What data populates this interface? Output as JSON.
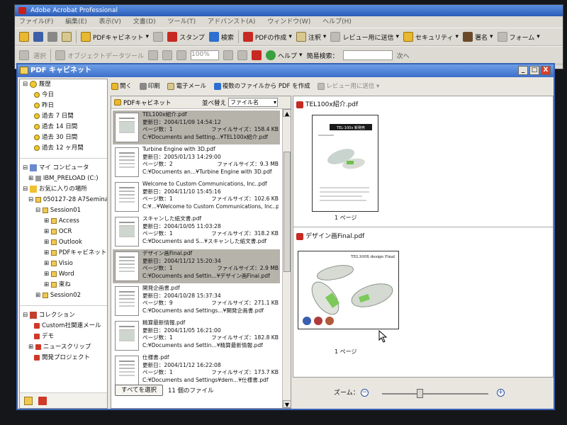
{
  "app": {
    "title": "Adobe Acrobat Professional",
    "menu": [
      "ファイル(F)",
      "編集(E)",
      "表示(V)",
      "文書(D)",
      "ツール(T)",
      "アドバンスト(A)",
      "ウィンドウ(W)",
      "ヘルプ(H)"
    ],
    "toolbar1": {
      "pdf_cabinet": "PDFキャビネット",
      "stamp": "スタンプ",
      "search": "検索",
      "create_pdf": "PDFの作成",
      "comment": "注釈",
      "send_for_review": "レビュー用に送信",
      "security": "セキュリティ",
      "sign": "署名",
      "forms": "フォーム"
    },
    "toolbar2": {
      "select": "選択",
      "object_data": "オブジェクトデータツール",
      "zoom_value": "100%",
      "help": "ヘルプ",
      "quick_search_label": "簡易検索：",
      "next": "次へ"
    }
  },
  "organizer": {
    "title": "PDF キャビネット",
    "window_buttons": {
      "minimize": "_",
      "maximize": "□",
      "close": "X"
    },
    "toolbar": {
      "open": "開く",
      "print": "印刷",
      "email": "電子メール",
      "combine": "複数のファイルから PDF を作成",
      "send_review": "レビュー用に送信"
    },
    "tree": {
      "history": {
        "label": "履歴",
        "items": [
          "今日",
          "昨日",
          "過去 7 日間",
          "過去 14 日間",
          "過去 30 日間",
          "過去 12 ヶ月間"
        ]
      },
      "my_computer": "マイ コンピュータ",
      "drive": "IBM_PRELOAD (C:)",
      "favorites": "お気に入りの場所",
      "fav_folder": "050127-28 A7Seminar",
      "session01": "Session01",
      "session01_children": [
        "Access",
        "OCR",
        "Outlook",
        "PDFキャビネット",
        "Visio",
        "Word",
        "束ね"
      ],
      "session02": "Session02",
      "collections": {
        "label": "コレクション",
        "items": [
          "Custom社関連メール",
          "デモ",
          "ニュースクリップ",
          "開発プロジェクト"
        ]
      }
    },
    "file_list": {
      "folder": "PDFキャビネット",
      "sort_label": "並べ替え",
      "sort_value": "ファイル名",
      "labels": {
        "modified": "更新日：",
        "pages": "ページ数：",
        "size": "ファイルサイズ："
      },
      "files": [
        {
          "name": "TEL100x紹介.pdf",
          "modified": "2004/11/09 14:54:12",
          "pages": "1",
          "size": "158.4 KB",
          "path": "C:¥Documents and Setting...¥TEL100x紹介.pdf",
          "selected": true
        },
        {
          "name": "Turbine Engine with 3D.pdf",
          "modified": "2005/01/13 14:29:00",
          "pages": "2",
          "size": "9.3 MB",
          "path": "C:¥Documents an...¥Turbine Engine with 3D.pdf",
          "selected": false
        },
        {
          "name": "Welcome to Custom Communications, Inc..pdf",
          "modified": "2004/11/10 15:45:16",
          "pages": "1",
          "size": "102.6 KB",
          "path": "C:¥...¥Welcome to Custom Communications, Inc..pc",
          "selected": false
        },
        {
          "name": "スキャンした紙文書.pdf",
          "modified": "2004/10/05 11:03:28",
          "pages": "1",
          "size": "318.2 KB",
          "path": "C:¥Documents and S...¥スキャンした紙文書.pdf",
          "selected": false
        },
        {
          "name": "デザイン画Final.pdf",
          "modified": "2004/11/12 15:20:34",
          "pages": "1",
          "size": "2.9 MB",
          "path": "C:¥Documents and Settin...¥デザイン画Final.pdf",
          "selected": true
        },
        {
          "name": "開発企画書.pdf",
          "modified": "2004/10/28 15:37:34",
          "pages": "9",
          "size": "271.1 KB",
          "path": "C:¥Documents and Settings...¥開発企画書.pdf",
          "selected": false
        },
        {
          "name": "精算最新情報.pdf",
          "modified": "2004/11/05 16:21:00",
          "pages": "1",
          "size": "182.8 KB",
          "path": "C:¥Documents and Settin...¥精算最新情報.pdf",
          "selected": false
        },
        {
          "name": "仕様書.pdf",
          "modified": "2004/11/12 16:22:08",
          "pages": "1",
          "size": "173.7 KB",
          "path": "C:¥Documents and Settings¥dem...¥仕様書.pdf",
          "selected": false
        }
      ],
      "select_all": "すべてを選択",
      "count": "11 個のファイル"
    },
    "preview": {
      "doc1": {
        "title": "TEL100x紹介.pdf",
        "page_label": "1 ページ",
        "thumb_heading": "TEL-100x 新発売"
      },
      "doc2": {
        "title": "デザイン画Final.pdf",
        "page_label": "1 ページ",
        "thumb_heading": "TEL100X design Final"
      },
      "zoom_label": "ズーム：",
      "zoom_level": 0.35
    }
  }
}
